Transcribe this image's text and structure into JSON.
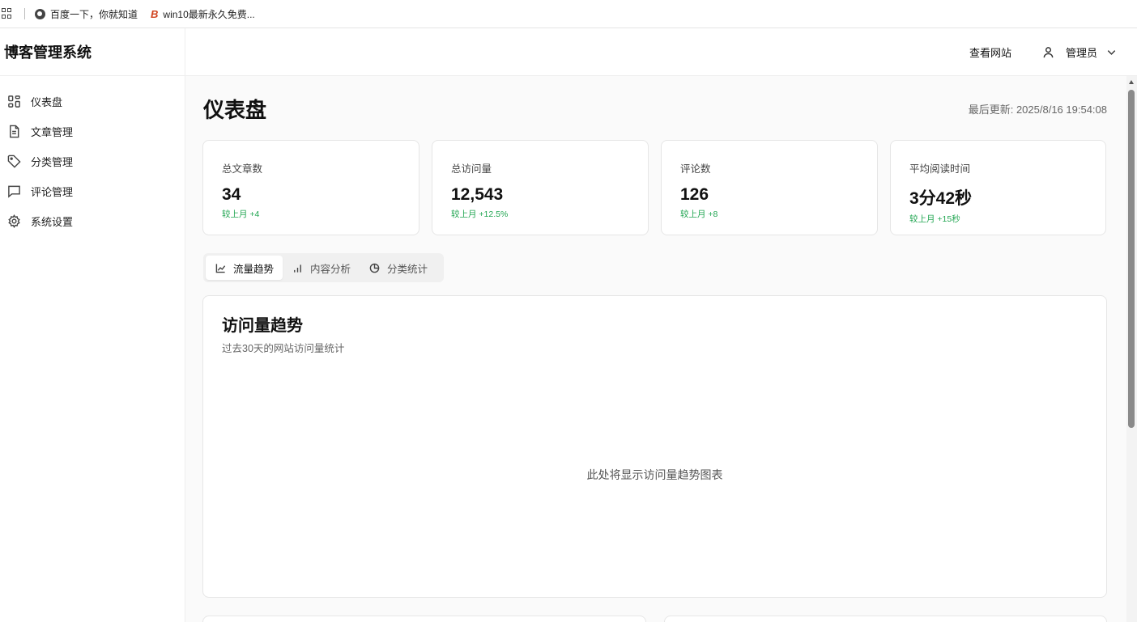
{
  "bookmarks": [
    {
      "label": "百度一下，你就知道",
      "icon": "globe-icon"
    },
    {
      "label": "win10最新永久免费...",
      "icon": "site-logo-icon",
      "logo_text": "B"
    }
  ],
  "sidebar": {
    "brand": "博客管理系统",
    "items": [
      {
        "label": "仪表盘",
        "icon": "dashboard-icon"
      },
      {
        "label": "文章管理",
        "icon": "document-icon"
      },
      {
        "label": "分类管理",
        "icon": "tag-icon"
      },
      {
        "label": "评论管理",
        "icon": "comment-icon"
      },
      {
        "label": "系统设置",
        "icon": "gear-icon"
      }
    ]
  },
  "header": {
    "view_site": "查看网站",
    "user": "管理员"
  },
  "page": {
    "title": "仪表盘",
    "last_update": "最后更新: 2025/8/16 19:54:08"
  },
  "stats": [
    {
      "label": "总文章数",
      "value": "34",
      "delta": "较上月 +4"
    },
    {
      "label": "总访问量",
      "value": "12,543",
      "delta": "较上月 +12.5%"
    },
    {
      "label": "评论数",
      "value": "126",
      "delta": "较上月 +8"
    },
    {
      "label": "平均阅读时间",
      "value": "3分42秒",
      "delta": "较上月 +15秒"
    }
  ],
  "tabs": [
    {
      "label": "流量趋势",
      "icon": "line-chart-icon",
      "active": true
    },
    {
      "label": "内容分析",
      "icon": "bar-chart-icon",
      "active": false
    },
    {
      "label": "分类统计",
      "icon": "pie-chart-icon",
      "active": false
    }
  ],
  "chart": {
    "title": "访问量趋势",
    "subtitle": "过去30天的网站访问量统计",
    "placeholder": "此处将显示访问量趋势图表"
  },
  "colors": {
    "accent_positive": "#22a652",
    "background": "#fafafa",
    "card_border": "#e6e6e6"
  }
}
